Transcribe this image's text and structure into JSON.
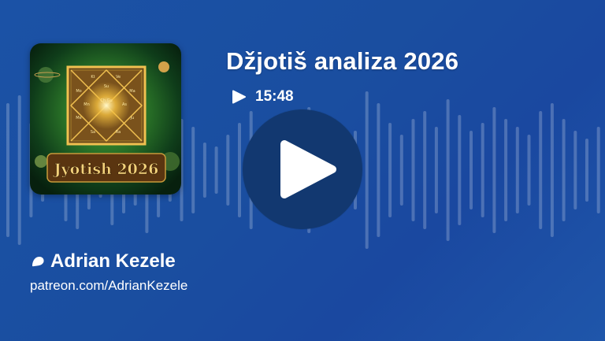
{
  "episode": {
    "title": "Džjotiš analiza 2026",
    "duration": "15:48"
  },
  "artwork": {
    "caption": "Jyotish 2026",
    "chart_labels": [
      "Kt",
      "Ve",
      "Su",
      "Mo",
      "Ma",
      "Me",
      "Ju",
      "Sa",
      "Ra",
      "Mn",
      "Ch Gu",
      "As"
    ],
    "accent_colors": [
      "#f0b93a",
      "#2e8a2a",
      "#5a3510"
    ]
  },
  "author": {
    "name": "Adrian Kezele",
    "icon": "patreon-icon",
    "link": "patreon.com/AdrianKezele"
  },
  "player": {
    "play_icon": "play-icon",
    "background_color": "#1b52a6",
    "button_color": "#123870"
  }
}
